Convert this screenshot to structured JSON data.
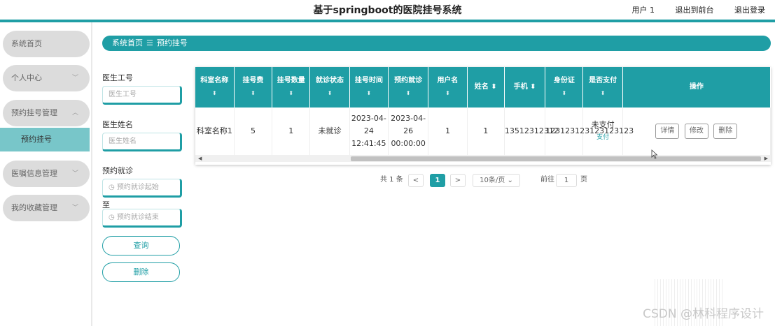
{
  "header": {
    "title": "基于springboot的医院挂号系统",
    "user": "用户 1",
    "back_front": "退出到前台",
    "logout": "退出登录"
  },
  "sidebar": {
    "items": [
      {
        "label": "系统首页"
      },
      {
        "label": "个人中心"
      },
      {
        "label": "预约挂号管理"
      },
      {
        "label": "预约挂号"
      },
      {
        "label": "医嘱信息管理"
      },
      {
        "label": "我的收藏管理"
      }
    ]
  },
  "breadcrumb": {
    "home": "系统首页",
    "sep": "☰",
    "current": "预约挂号"
  },
  "filters": {
    "doctor_id_label": "医生工号",
    "doctor_id_placeholder": "医生工号",
    "doctor_name_label": "医生姓名",
    "doctor_name_placeholder": "医生姓名",
    "visit_label": "预约就诊",
    "visit_start_placeholder": "◷ 预约就诊起始",
    "to_label": "至",
    "visit_end_placeholder": "◷ 预约就诊结束",
    "query_button": "查询",
    "delete_button": "删除"
  },
  "table": {
    "sort_glyph": "⬍",
    "columns": [
      "科室名称",
      "挂号费",
      "挂号数量",
      "就诊状态",
      "挂号时间",
      "预约就诊",
      "用户名",
      "姓名",
      "手机",
      "身份证",
      "是否支付",
      "操作"
    ],
    "row": {
      "dept": "科室名称1",
      "fee": "5",
      "count": "1",
      "status": "未就诊",
      "reg_time": "2023-04-24 12:41:45",
      "visit_time": "2023-04-26 00:00:00",
      "username": "1",
      "name": "1",
      "phone": "13512312312",
      "id_card": "123123123123123123",
      "paid": "未支付",
      "pay_link": "支付",
      "actions": [
        "详情",
        "修改",
        "删除"
      ]
    }
  },
  "pagination": {
    "total": "共 1 条",
    "prev": "<",
    "current": "1",
    "next": ">",
    "page_size": "10条/页",
    "goto_label": "前往",
    "goto_value": "1",
    "page_suffix": "页"
  },
  "watermark": "CSDN @林科程序设计",
  "colors": {
    "accent": "#1f9ea5",
    "sidebar_active": "#78c6c9",
    "menu_bg": "#dcdcdc"
  }
}
